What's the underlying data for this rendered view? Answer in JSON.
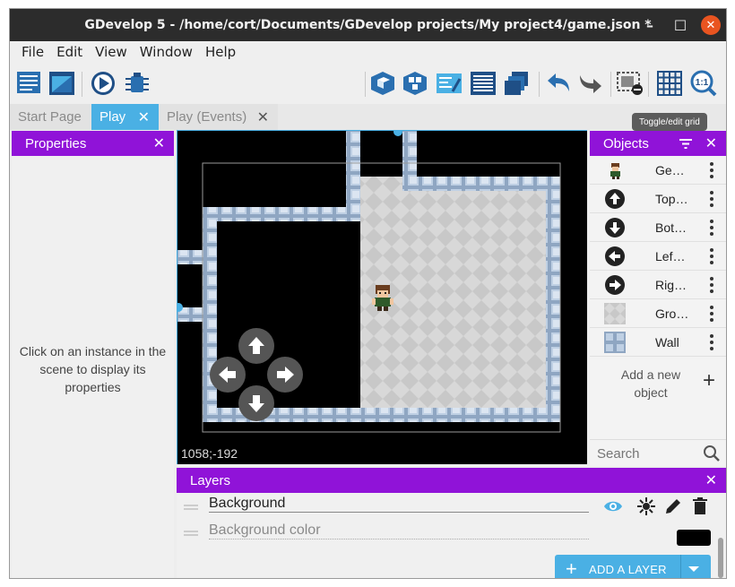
{
  "window": {
    "title": "GDevelop 5 - /home/cort/Documents/GDevelop projects/My project4/game.json *",
    "controls": {
      "minimize": "–",
      "maximize": "☐",
      "close": "✕"
    }
  },
  "menu": [
    "File",
    "Edit",
    "View",
    "Window",
    "Help"
  ],
  "toolbar": {
    "icons": [
      "project-manager-icon",
      "scene-editor-icon",
      "preview-icon",
      "debugger-icon",
      "objects-editor-icon",
      "object-groups-icon",
      "instance-properties-icon",
      "instances-list-icon",
      "layers-icon",
      "undo-icon",
      "redo-icon",
      "hide-windows-icon",
      "grid-icon",
      "zoom-reset-icon"
    ],
    "zoom_reset_label": "1:1"
  },
  "tabs": [
    {
      "label": "Start Page",
      "active": false,
      "closable": false
    },
    {
      "label": "Play",
      "active": true,
      "closable": true
    },
    {
      "label": "Play (Events)",
      "active": false,
      "closable": true
    }
  ],
  "tooltip": "Toggle/edit grid",
  "properties": {
    "title": "Properties",
    "close": "✕",
    "message": "Click on an instance in the scene to display its properties"
  },
  "scene": {
    "coordinates": "1058;-192",
    "background_color": "#000000"
  },
  "objects": {
    "title": "Objects",
    "close": "✕",
    "items": [
      {
        "label": "Ge…",
        "icon": "character-sprite-icon"
      },
      {
        "label": "Top…",
        "icon": "arrow-up-circle-icon"
      },
      {
        "label": "Bot…",
        "icon": "arrow-down-circle-icon"
      },
      {
        "label": "Lef…",
        "icon": "arrow-left-circle-icon"
      },
      {
        "label": "Rig…",
        "icon": "arrow-right-circle-icon"
      },
      {
        "label": "Gro…",
        "icon": "ground-tile-icon"
      },
      {
        "label": "Wall",
        "icon": "wall-tile-icon"
      }
    ],
    "add_label": "Add a new object",
    "search_placeholder": "Search"
  },
  "layers": {
    "title": "Layers",
    "close": "✕",
    "layer_name": "Background",
    "bg_color_label": "Background color",
    "bg_color": "#000000",
    "add_button": "ADD A LAYER"
  },
  "colors": {
    "accent_purple": "#9013d8",
    "accent_blue": "#4ab0e4",
    "titlebar": "#2c2c2c",
    "close_orange": "#e95420"
  }
}
